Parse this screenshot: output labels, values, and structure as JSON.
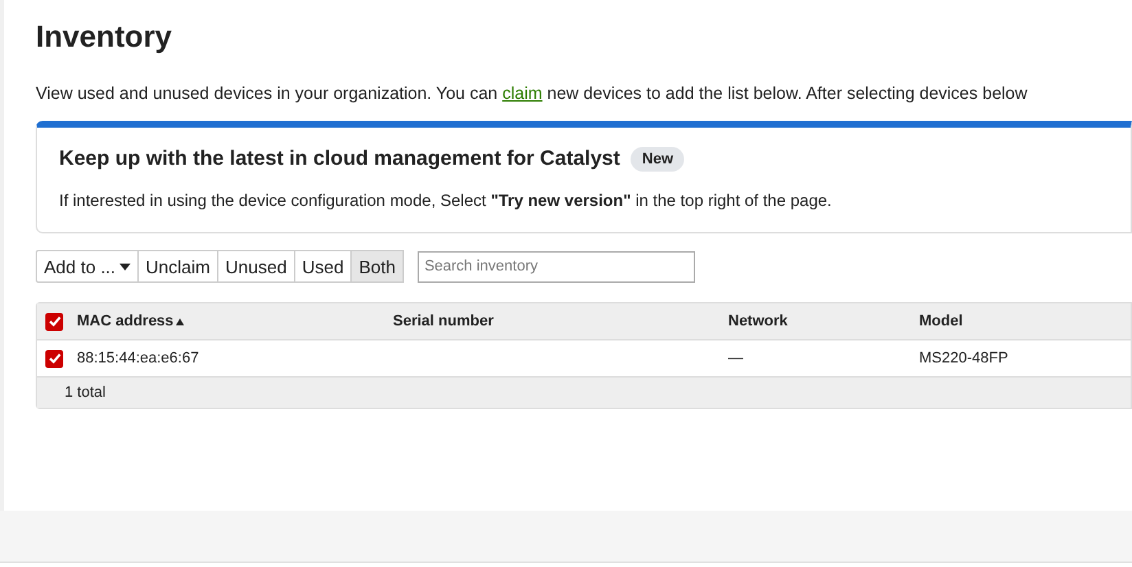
{
  "title": "Inventory",
  "intro": {
    "before": "View used and unused devices in your organization. You can",
    "link": "claim",
    "after": "new devices to add the list below. After selecting devices below"
  },
  "banner": {
    "title": "Keep up with the latest in cloud management for Catalyst",
    "badge": "New",
    "text": "If interested in using the device configuration mode, Select **\"Try new version\"** in the top right of the page."
  },
  "toolbar": {
    "buttons": [
      {
        "label": "Add to ...",
        "kind": "dropdown",
        "selected": false
      },
      {
        "label": "Unclaim",
        "kind": "button",
        "selected": false
      },
      {
        "label": "Unused",
        "kind": "button",
        "selected": false
      },
      {
        "label": "Used",
        "kind": "button",
        "selected": false
      },
      {
        "label": "Both",
        "kind": "button",
        "selected": true
      }
    ],
    "search": {
      "placeholder": "Search inventory"
    }
  },
  "table": {
    "select_all_checked": true,
    "columns": [
      {
        "label": "MAC address",
        "sorted": true
      },
      {
        "label": "Serial number",
        "sorted": false
      },
      {
        "label": "Network",
        "sorted": false
      },
      {
        "label": "Model",
        "sorted": false
      }
    ],
    "rows": [
      {
        "checked": true,
        "cells": [
          "88:15:44:ea:e6:67",
          "",
          "—",
          "MS220-48FP"
        ]
      }
    ],
    "footer": "1 total"
  }
}
